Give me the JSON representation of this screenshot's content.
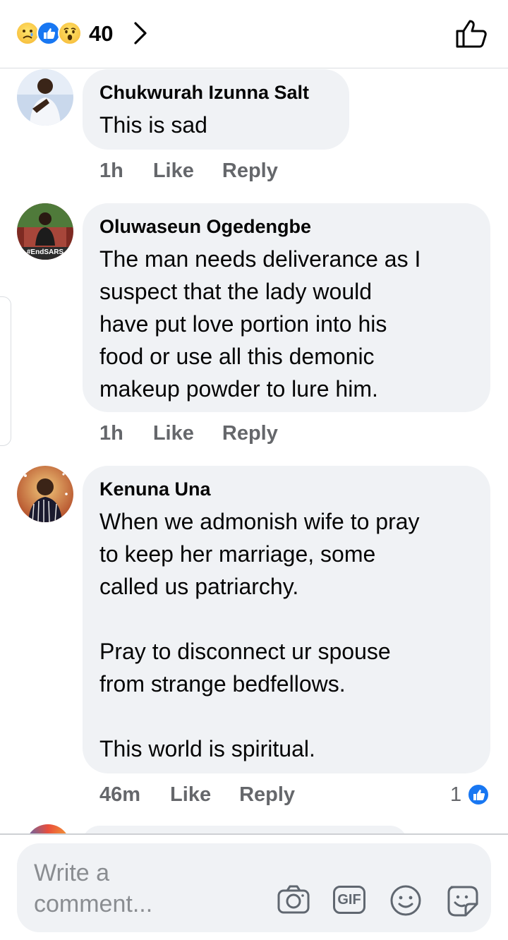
{
  "header": {
    "reaction_icons": [
      "sad-reaction-icon",
      "like-reaction-icon",
      "wow-reaction-icon"
    ],
    "reaction_count": "40"
  },
  "comments": [
    {
      "author": "Chukwurah Izunna Salt",
      "text": "This is sad",
      "time": "1h",
      "like_label": "Like",
      "reply_label": "Reply"
    },
    {
      "author": "Oluwaseun Ogedengbe",
      "avatar_badge": "#EndSARS",
      "text": " The man needs deliverance as I\nsuspect that the lady would\nhave put love portion into his\nfood or use all this demonic\nmakeup powder to lure him.",
      "time": "1h",
      "like_label": "Like",
      "reply_label": "Reply"
    },
    {
      "author": "Kenuna Una",
      "text": "When we admonish wife to pray\nto keep her marriage, some\ncalled us patriarchy.\n\nPray to disconnect ur spouse\nfrom strange bedfellows.\n\nThis world is spiritual.",
      "time": "46m",
      "like_label": "Like",
      "reply_label": "Reply",
      "reaction_count": "1"
    }
  ],
  "composer": {
    "placeholder": "Write a\ncomment...",
    "icons": [
      "camera-icon",
      "gif-icon",
      "emoji-icon",
      "sticker-icon"
    ],
    "gif_label": "GIF"
  },
  "colors": {
    "accent": "#1877f2",
    "bubble": "#f0f2f5",
    "meta": "#65676b"
  }
}
